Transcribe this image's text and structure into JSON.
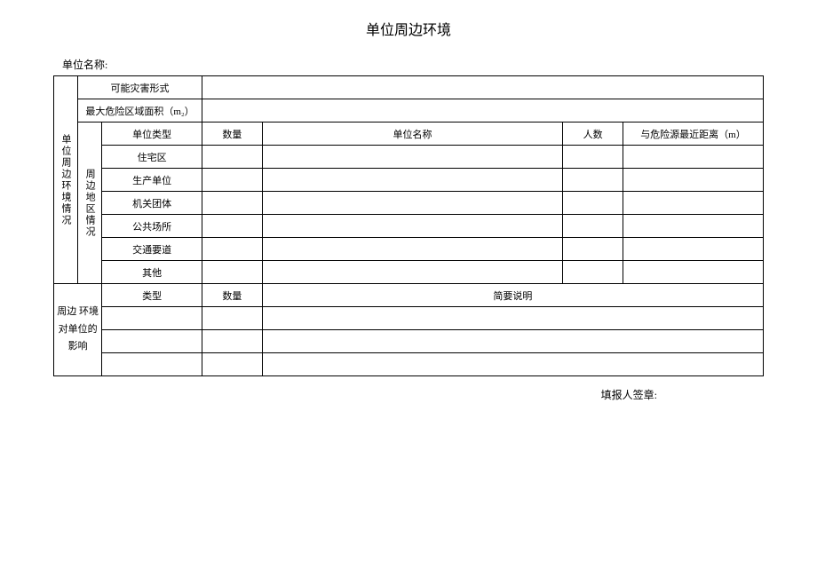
{
  "title": "单位周边环境",
  "unitNameLabel": "单位名称:",
  "section1Label": "单位周边环境情况",
  "section2Label": "周边地区情况",
  "row1Label": "可能灾害形式",
  "row2Label": "最大危险区域面积（m₂）",
  "headers": {
    "unitType": "单位类型",
    "quantity": "数量",
    "unitName": "单位名称",
    "people": "人数",
    "distance": "与危险源最近距离（m）"
  },
  "unitTypes": {
    "residential": "住宅区",
    "production": "生产单位",
    "agency": "机关团体",
    "public": "公共场所",
    "traffic": "交通要道",
    "other": "其他"
  },
  "section3Label": "周边 环境 对单位的 影响",
  "impactHeaders": {
    "type": "类型",
    "quantity": "数量",
    "description": "简要说明"
  },
  "signature": "填报人签章:"
}
